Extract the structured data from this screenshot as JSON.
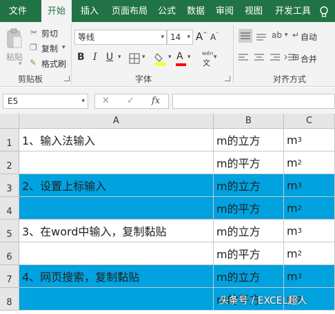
{
  "tabs": [
    "文件",
    "开始",
    "插入",
    "页面布局",
    "公式",
    "数据",
    "审阅",
    "视图",
    "开发工具"
  ],
  "clipboard": {
    "paste": "粘贴",
    "cut": "剪切",
    "copy": "复制",
    "format_painter": "格式刷",
    "group_label": "剪贴板"
  },
  "font": {
    "name": "等线",
    "size": "14",
    "grow": "A",
    "shrink": "A",
    "bold": "B",
    "italic": "I",
    "underline": "U",
    "font_color_glyph": "A",
    "phonetic_top": "wén",
    "phonetic_bottom": "文",
    "group_label": "字体"
  },
  "alignment": {
    "wrap": "自动",
    "merge": "合并",
    "group_label": "对齐方式"
  },
  "formula_bar": {
    "name_box": "E5",
    "cancel": "✕",
    "confirm": "✓",
    "fx": "fx",
    "value": ""
  },
  "colors": {
    "ribbon_green": "#217346",
    "highlight_blue": "#00a2e0"
  },
  "columns": [
    "A",
    "B",
    "C"
  ],
  "rows": [
    {
      "num": "1",
      "a": "1、输入法输入",
      "b": "m的立方",
      "c_base": "m",
      "c_sup": "3",
      "blue": false
    },
    {
      "num": "2",
      "a": "",
      "b": "m的平方",
      "c_base": "m",
      "c_sup": "2",
      "blue": false
    },
    {
      "num": "3",
      "a": "2、设置上标输入",
      "b": "m的立方",
      "c_base": "m",
      "c_sup": "3",
      "blue": true
    },
    {
      "num": "4",
      "a": "",
      "b": "m的平方",
      "c_base": "m",
      "c_sup": "2",
      "blue": true
    },
    {
      "num": "5",
      "a": "3、在word中输入，复制黏贴",
      "b": "m的立方",
      "c_base": "m",
      "c_sup": "3",
      "blue": false
    },
    {
      "num": "6",
      "a": "",
      "b": "m的平方",
      "c_base": "m",
      "c_sup": "2",
      "blue": false
    },
    {
      "num": "7",
      "a": "4、网页搜索，复制黏贴",
      "b": "m的立方",
      "c_base": "m",
      "c_sup": "3",
      "blue": true
    },
    {
      "num": "8",
      "a": "",
      "b": "m的平方",
      "c_base": "m",
      "c_sup": "2",
      "blue": true
    }
  ],
  "watermark": "头条号 / EXCEL超人"
}
